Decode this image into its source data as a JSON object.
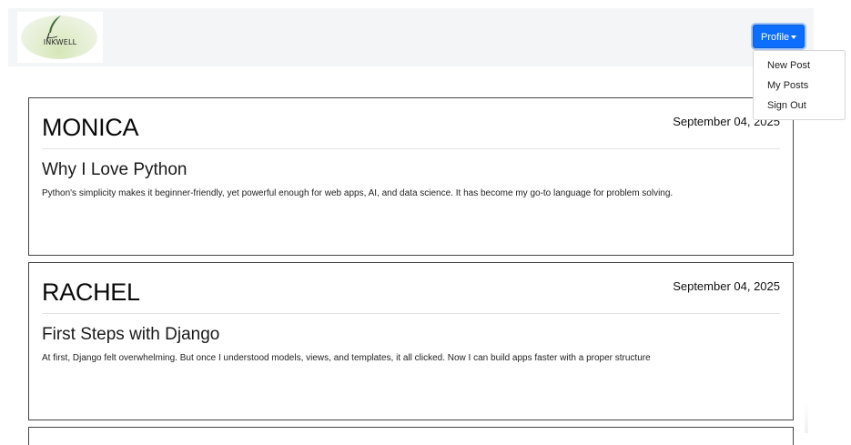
{
  "navbar": {
    "logo_text": "INKWELL",
    "profile_button_label": "Profile",
    "profile_menu": [
      "New Post",
      "My Posts",
      "Sign Out"
    ]
  },
  "posts": [
    {
      "author": "MONICA",
      "date": "September 04, 2025",
      "title": "Why I Love Python",
      "body": "Python's simplicity makes it beginner-friendly, yet powerful enough for web apps, AI, and data science. It has become my go-to language for problem solving."
    },
    {
      "author": "RACHEL",
      "date": "September 04, 2025",
      "title": "First Steps with Django",
      "body": "At first, Django felt overwhelming. But once I understood models, views, and templates, it all clicked. Now I can build apps faster with a proper structure"
    }
  ],
  "colors": {
    "accent": "#0d6efd",
    "navbar_bg": "#f4f5f6",
    "card_border": "#444444"
  }
}
